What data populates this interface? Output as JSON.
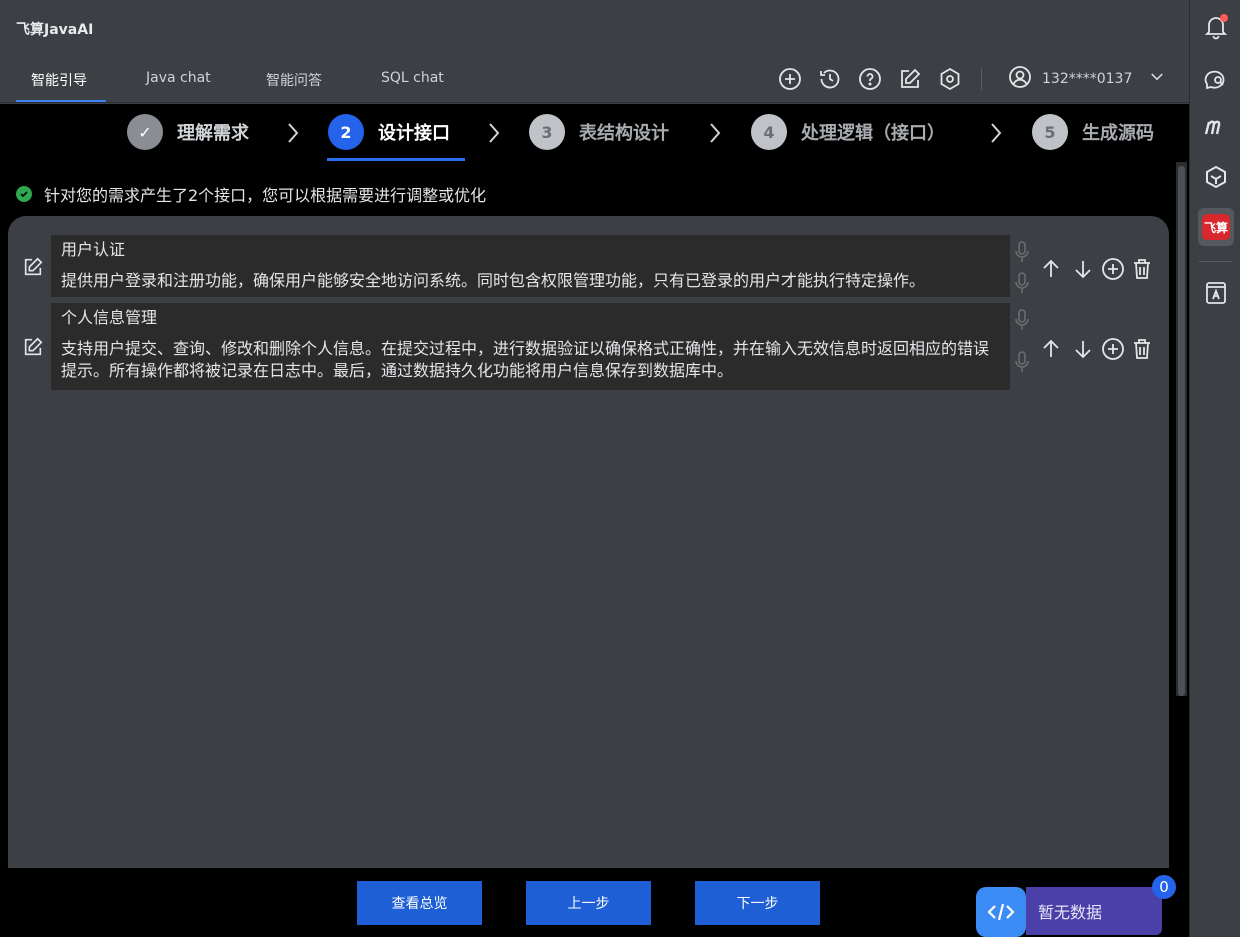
{
  "app": {
    "title": "飞算JavaAI"
  },
  "tabs": [
    {
      "label": "智能引导",
      "active": true
    },
    {
      "label": "Java chat"
    },
    {
      "label": "智能问答"
    },
    {
      "label": "SQL chat"
    }
  ],
  "toolbar": {
    "icons": [
      "plus-circle-icon",
      "history-icon",
      "help-circle-icon",
      "edit-icon",
      "settings-hex-icon"
    ],
    "user": "132****0137"
  },
  "steps": [
    {
      "number": "✓",
      "label": "理解需求",
      "state": "done"
    },
    {
      "number": "2",
      "label": "设计接口",
      "state": "current"
    },
    {
      "number": "3",
      "label": "表结构设计",
      "state": "todo"
    },
    {
      "number": "4",
      "label": "处理逻辑（接口）",
      "state": "todo"
    },
    {
      "number": "5",
      "label": "生成源码",
      "state": "todo"
    }
  ],
  "info_text": "针对您的需求产生了2个接口，您可以根据需要进行调整或优化",
  "interfaces": [
    {
      "title": "用户认证",
      "desc": "提供用户登录和注册功能，确保用户能够安全地访问系统。同时包含权限管理功能，只有已登录的用户才能执行特定操作。"
    },
    {
      "title": "个人信息管理",
      "desc": "支持用户提交、查询、修改和删除个人信息。在提交过程中，进行数据验证以确保格式正确性，并在输入无效信息时返回相应的错误提示。所有操作都将被记录在日志中。最后，通过数据持久化功能将用户信息保存到数据库中。"
    }
  ],
  "buttons": {
    "overview": "查看总览",
    "prev": "上一步",
    "next": "下一步"
  },
  "widget": {
    "status": "暂无数据",
    "badge": "0"
  },
  "rail": {
    "logo_text": "飞算",
    "colors": {
      "logo": "#d8272d",
      "accent": "#2563eb"
    }
  }
}
